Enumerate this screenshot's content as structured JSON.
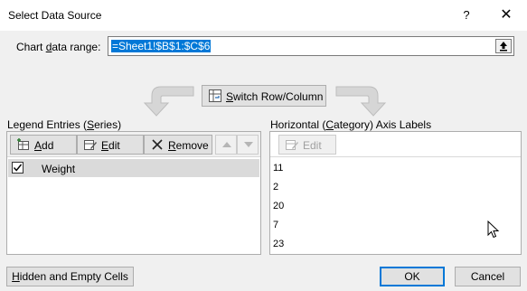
{
  "window": {
    "title": "Select Data Source",
    "help": "?",
    "close": "✕"
  },
  "range": {
    "label_pre": "Chart ",
    "label_ul": "d",
    "label_post": "ata range:",
    "value": "=Sheet1!$B$1:$C$6"
  },
  "switch_button": {
    "pre": "",
    "ul": "W",
    "post": "Switch Row/Column",
    "label": "Switch Row/Column"
  },
  "legend": {
    "heading_pre": "Legend Entries (",
    "heading_ul": "S",
    "heading_post": "eries)",
    "add": "Add",
    "edit": "Edit",
    "remove": "Remove",
    "series": [
      {
        "name": "Weight",
        "checked": true
      }
    ]
  },
  "category": {
    "heading_pre": "Horizontal (",
    "heading_ul": "C",
    "heading_post": "ategory) Axis Labels",
    "edit": "Edit",
    "items": [
      "11",
      "2",
      "20",
      "7",
      "23"
    ]
  },
  "footer": {
    "hidden_cells": "Hidden and Empty Cells",
    "ok": "OK",
    "cancel": "Cancel"
  }
}
